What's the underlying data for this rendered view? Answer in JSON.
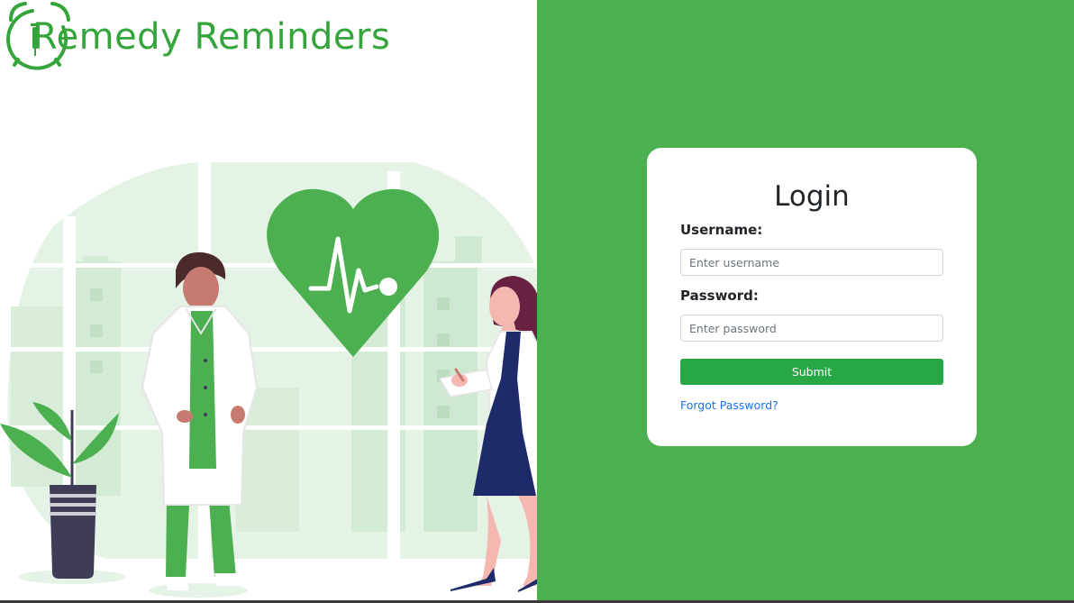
{
  "brand": {
    "name": "Remedy Reminders",
    "color": "#34a53a"
  },
  "theme": {
    "background_right": "#4caf50",
    "submit_color": "#28a745",
    "link_color": "#1a73e8"
  },
  "login": {
    "title": "Login",
    "username_label": "Username:",
    "username_placeholder": "Enter username",
    "username_value": "",
    "password_label": "Password:",
    "password_placeholder": "Enter password",
    "password_value": "",
    "submit_label": "Submit",
    "forgot_label": "Forgot Password?"
  },
  "illustration": {
    "icon": "heart-pulse-icon"
  }
}
